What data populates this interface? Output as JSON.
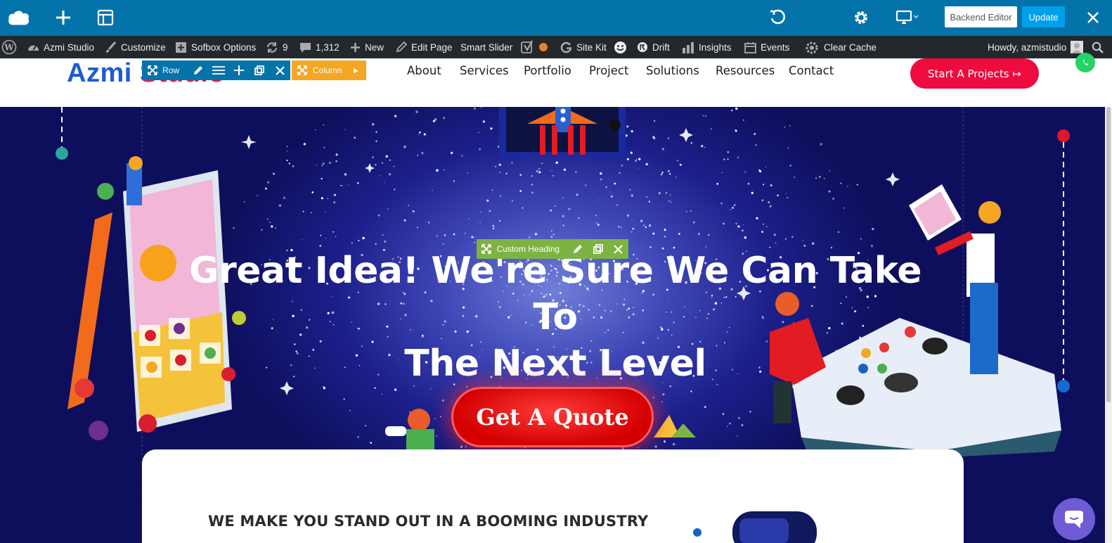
{
  "builder_toolbar": {
    "backend_editor_label": "Backend Editor",
    "update_label": "Update"
  },
  "admin_bar": {
    "site_name": "Azmi Studio",
    "customize": "Customize",
    "sofbox_options": "Sofbox Options",
    "updates_count": "9",
    "comments_count": "1,312",
    "new": "New",
    "edit_page": "Edit Page",
    "smart_slider": "Smart Slider",
    "site_kit": "Site Kit",
    "drift": "Drift",
    "insights": "Insights",
    "events": "Events",
    "clear_cache": "Clear Cache",
    "howdy": "Howdy, azmistudio"
  },
  "header": {
    "logo_part1": "Azmi",
    "logo_part2": "Studio",
    "nav": [
      "About",
      "Services",
      "Portfolio",
      "Project",
      "Solutions",
      "Resources",
      "Contact"
    ],
    "cta_label": "Start A Projects ↦"
  },
  "editor_controls": {
    "row_label": "Row",
    "column_label": "Column",
    "heading_label": "Custom Heading"
  },
  "hero": {
    "title_line1": "Great Idea! We're Sure We Can Take To",
    "title_line2": "The Next Level",
    "quote_button": "Get A Quote"
  },
  "section": {
    "title": "WE MAKE YOU STAND OUT IN A BOOMING INDUSTRY"
  },
  "colors": {
    "builder_blue": "#0473aa",
    "cta_red": "#ee0b3e",
    "column_orange": "#f5a623",
    "heading_green": "#7cb342",
    "hero_navy": "#1c1f8a"
  }
}
